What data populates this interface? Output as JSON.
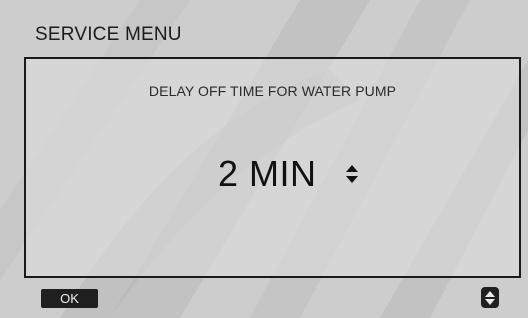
{
  "header": {
    "title": "SERVICE MENU"
  },
  "setting": {
    "label": "DELAY OFF TIME FOR WATER PUMP",
    "value": "2 MIN",
    "adjust_icon": "up-down-arrows-icon"
  },
  "footer": {
    "ok_label": "OK",
    "scroll_icon": "up-down-arrows-icon"
  },
  "colors": {
    "screen_background": "#cdcdcd",
    "text": "#111111",
    "button_background": "#1f1f1f"
  }
}
